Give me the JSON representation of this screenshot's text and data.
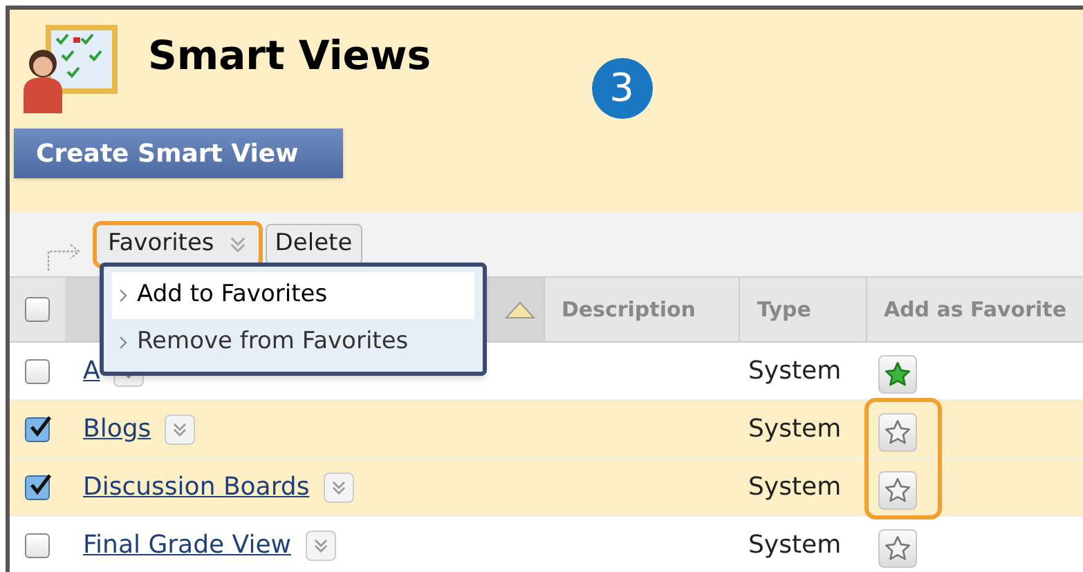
{
  "page_header": {
    "title": "Smart Views",
    "step_badge": "3",
    "create_button": "Create Smart View"
  },
  "toolbar": {
    "favorites_button": {
      "label": "Favorites",
      "highlighted": true,
      "expanded": true
    },
    "delete_button": "Delete"
  },
  "favorites_menu": [
    {
      "label": "Add to Favorites",
      "selected": true
    },
    {
      "label": "Remove from Favorites",
      "selected": false
    }
  ],
  "table": {
    "select_all_checked": false,
    "columns": [
      "Description",
      "Type",
      "Add as Favorite"
    ],
    "rows": [
      {
        "name": "A",
        "checked": false,
        "type": "System",
        "favorite": true,
        "callout": false
      },
      {
        "name": "Blogs",
        "checked": true,
        "type": "System",
        "favorite": false,
        "callout": true
      },
      {
        "name": "Discussion Boards",
        "checked": true,
        "type": "System",
        "favorite": false,
        "callout": true
      },
      {
        "name": "Final Grade View",
        "checked": false,
        "type": "System",
        "favorite": false,
        "callout": false
      }
    ]
  }
}
